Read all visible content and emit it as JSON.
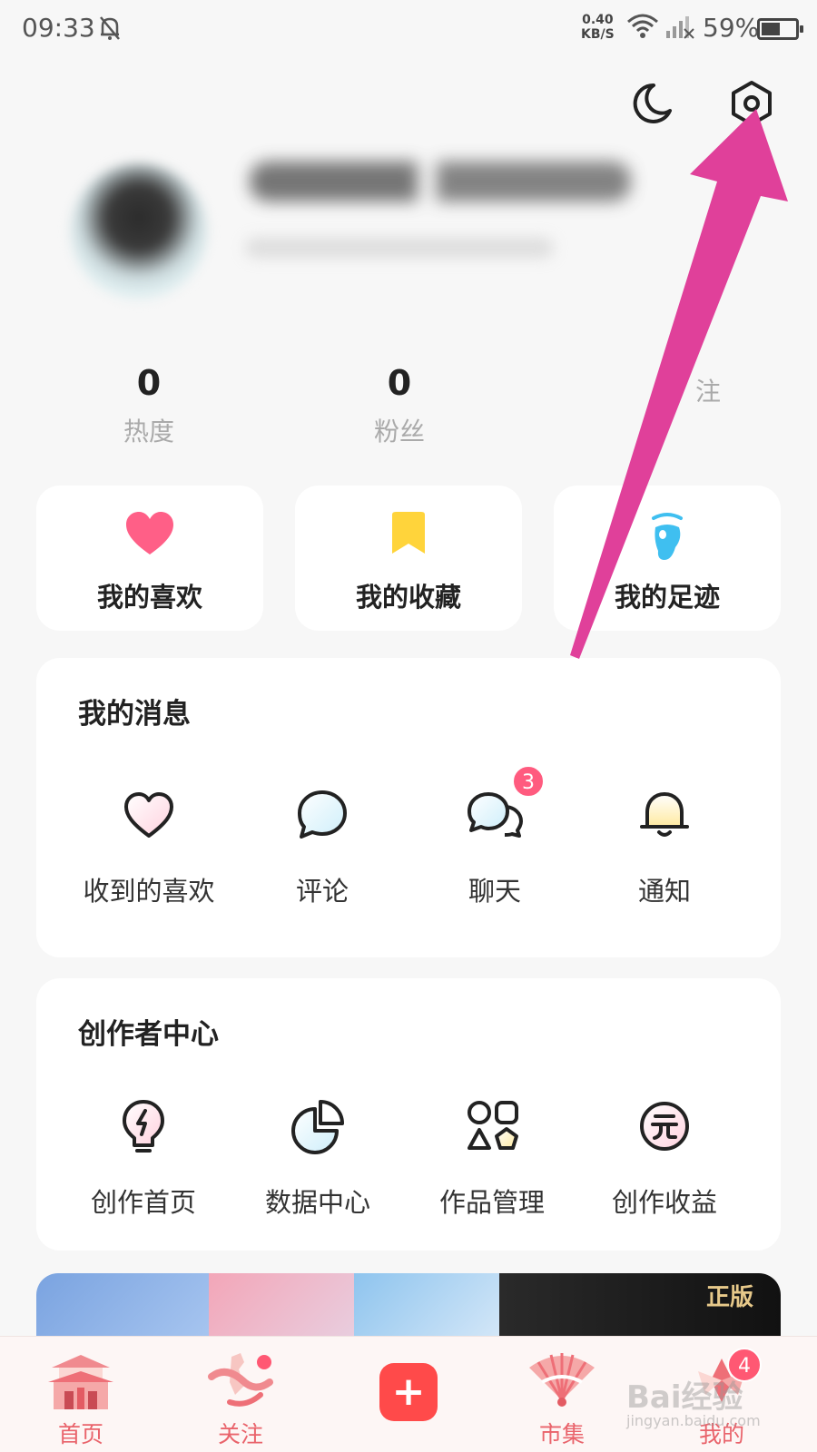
{
  "status_bar": {
    "time": "09:33",
    "net_speed_value": "0.40",
    "net_speed_unit": "KB/S",
    "battery": "59%",
    "battery_level": 0.59
  },
  "header_icons": {
    "theme": "moon-icon",
    "settings": "gear-icon"
  },
  "stats": [
    {
      "value": "0",
      "label": "热度"
    },
    {
      "value": "0",
      "label": "粉丝"
    },
    {
      "value": "",
      "label": "注"
    }
  ],
  "quick_links": [
    {
      "label": "我的喜欢",
      "icon": "heart-icon",
      "color": "#ff5f87"
    },
    {
      "label": "我的收藏",
      "icon": "bookmark-icon",
      "color": "#ffd43b"
    },
    {
      "label": "我的足迹",
      "icon": "footprint-icon",
      "color": "#3fbff0"
    }
  ],
  "messages": {
    "title": "我的消息",
    "items": [
      {
        "label": "收到的喜欢",
        "icon": "heart-outline-icon"
      },
      {
        "label": "评论",
        "icon": "comment-icon"
      },
      {
        "label": "聊天",
        "icon": "chat-icon",
        "badge": "3"
      },
      {
        "label": "通知",
        "icon": "bell-icon"
      }
    ]
  },
  "creator": {
    "title": "创作者中心",
    "items": [
      {
        "label": "创作首页",
        "icon": "bulb-icon"
      },
      {
        "label": "数据中心",
        "icon": "pie-chart-icon"
      },
      {
        "label": "作品管理",
        "icon": "shapes-icon"
      },
      {
        "label": "创作收益",
        "icon": "yuan-icon"
      }
    ]
  },
  "banner": {
    "text": "正版"
  },
  "tabbar": {
    "items": [
      {
        "label": "首页",
        "icon": "palace-icon"
      },
      {
        "label": "关注",
        "icon": "follow-icon"
      },
      {
        "label": "",
        "icon": "plus-icon"
      },
      {
        "label": "市集",
        "icon": "fan-icon"
      },
      {
        "label": "我的",
        "icon": "profile-icon",
        "badge": "4"
      }
    ],
    "plus_symbol": "+"
  },
  "watermark": {
    "text": "Bai经验",
    "sub": "jingyan.baidu.com"
  },
  "colors": {
    "accent": "#e9636b",
    "arrow": "#e0409a"
  }
}
